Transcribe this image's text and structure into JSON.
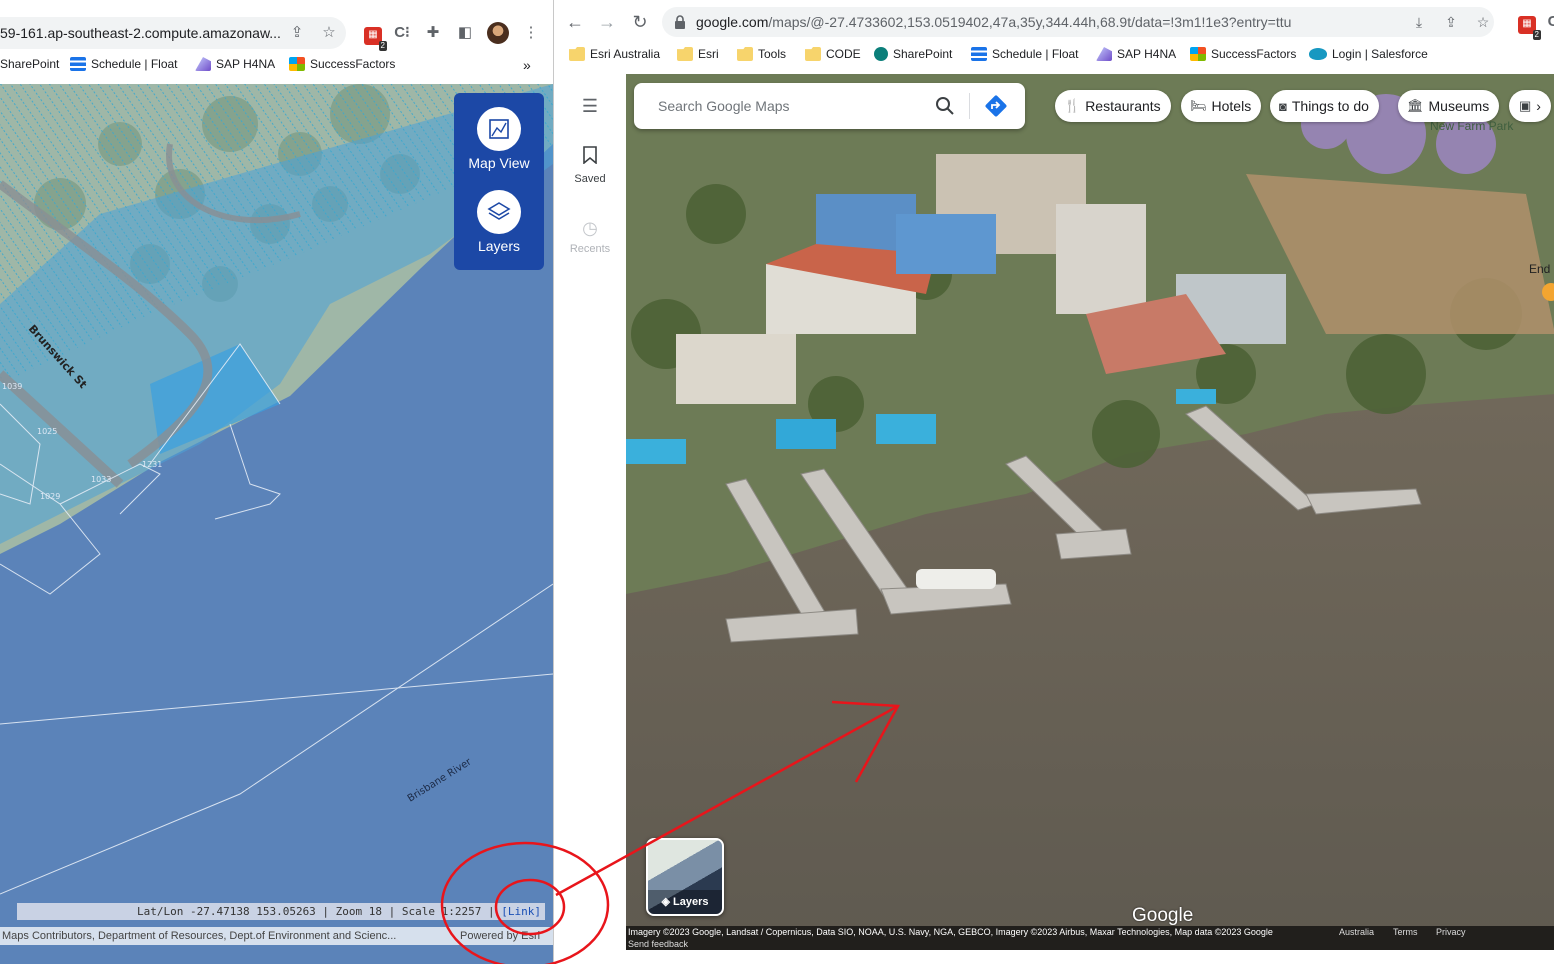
{
  "left_browser": {
    "url": "59-161.ap-southeast-2.compute.amazonaw...",
    "extension_badge_count": "2",
    "bookmarks": [
      {
        "label": "SharePoint",
        "icon": "sharepoint-icon"
      },
      {
        "label": "Schedule | Float",
        "icon": "float-icon"
      },
      {
        "label": "SAP H4NA",
        "icon": "sap-icon"
      },
      {
        "label": "SuccessFactors",
        "icon": "successfactors-icon"
      }
    ],
    "more_bookmarks": "»"
  },
  "left_map": {
    "controls": {
      "map_view_label": "Map View",
      "layers_label": "Layers"
    },
    "labels": {
      "street": "Brunswick St",
      "river": "Brisbane River",
      "parcel_1": "1039",
      "parcel_2": "1025",
      "parcel_3": "1231",
      "parcel_4": "1033",
      "parcel_5": "1029"
    },
    "status": {
      "text": "Lat/Lon -27.47138 153.05263 | Zoom 18 | Scale 1:2257 | ",
      "link": "[Link]"
    },
    "attribution": "Maps Contributors, Department of Resources, Dept.of Environment and Scienc...",
    "powered_by": "Powered by Esri",
    "colors": {
      "water": "#5b83b9",
      "flood": "#4aa3d8",
      "control_bg": "#1c48a6"
    }
  },
  "right_browser": {
    "url_host": "google.com",
    "url_path": "/maps/@-27.4733602,153.0519402,47a,35y,344.44h,68.9t/data=!3m1!1e3?entry=ttu",
    "extension_badge_count": "2",
    "bookmarks": [
      {
        "label": "Esri Australia",
        "icon": "folder-icon"
      },
      {
        "label": "Esri",
        "icon": "folder-icon"
      },
      {
        "label": "Tools",
        "icon": "folder-icon"
      },
      {
        "label": "CODE",
        "icon": "folder-icon"
      },
      {
        "label": "SharePoint",
        "icon": "sharepoint-icon"
      },
      {
        "label": "Schedule | Float",
        "icon": "float-icon"
      },
      {
        "label": "SAP H4NA",
        "icon": "sap-icon"
      },
      {
        "label": "SuccessFactors",
        "icon": "successfactors-icon"
      },
      {
        "label": "Login | Salesforce",
        "icon": "salesforce-icon"
      }
    ]
  },
  "google_maps": {
    "sidebar": {
      "saved": "Saved",
      "recents": "Recents"
    },
    "search_placeholder": "Search Google Maps",
    "chips": [
      "Restaurants",
      "Hotels",
      "Things to do",
      "Museums"
    ],
    "map_labels": {
      "park": "New Farm Park",
      "place": "End"
    },
    "layers_label": "Layers",
    "logo": "Google",
    "attribution": "Imagery ©2023 Google, Landsat / Copernicus, Data SIO, NOAA, U.S. Navy, NGA, GEBCO, Imagery ©2023 Airbus, Maxar Technologies, Map data ©2023 Google",
    "send_feedback": "Send feedback",
    "footer_links": [
      "Australia",
      "Terms",
      "Privacy"
    ],
    "colors": {
      "annotation": "#e8151b",
      "river": "#6e6759"
    }
  }
}
